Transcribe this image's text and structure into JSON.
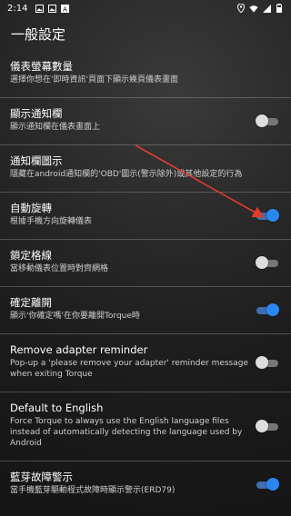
{
  "status_bar": {
    "time": "2:14",
    "icons_left": [
      "image-icon",
      "image-icon",
      "a-icon"
    ],
    "icons_right": [
      "location-icon",
      "wifi-icon",
      "signal-icon",
      "battery-icon"
    ]
  },
  "header": {
    "title": "一般設定"
  },
  "settings": [
    {
      "title": "儀表螢幕數量",
      "subtitle": "選擇你想在'即時資訊'頁面下顯示幾頁儀表畫面",
      "toggle": null
    },
    {
      "title": "顯示通知欄",
      "subtitle": "顯示通知欄在儀表畫面上",
      "toggle": "off"
    },
    {
      "title": "通知欄圖示",
      "subtitle": "隱藏在android通知欄的'OBD'圖示(警示除外)或其他設定的行為",
      "toggle": null
    },
    {
      "title": "自動旋轉",
      "subtitle": "根據手機方向旋轉儀表",
      "toggle": "on"
    },
    {
      "title": "鎖定格線",
      "subtitle": "當移動儀表位置時對齊網格",
      "toggle": "off"
    },
    {
      "title": "確定離開",
      "subtitle": "顯示'你確定嗎'在你要離開Torque時",
      "toggle": "on"
    },
    {
      "title": "Remove adapter reminder",
      "subtitle": "Pop-up a 'please remove your adapter' reminder message when exiting Torque",
      "toggle": "off"
    },
    {
      "title": "Default to English",
      "subtitle": "Force Torque to always use the English language files instead of automatically detecting the language used by Android",
      "toggle": "off"
    },
    {
      "title": "藍芽故障警示",
      "subtitle": "當手機藍芽驅動程式故障時顯示警示(ERD79)",
      "toggle": "on"
    }
  ],
  "colors": {
    "accent": "#2a87f0",
    "annotation_arrow": "#e23b2e"
  }
}
